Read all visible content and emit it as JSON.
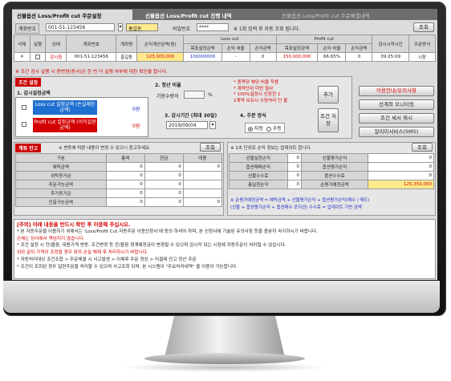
{
  "tabs": [
    "선물옵션 Loss/Profit cut 주문설정",
    "선물옵션 Loss/Profit cut 진행 내역",
    "선물옵션 Loss/Profit cut 주문체결내역"
  ],
  "account": {
    "label": "계좌번호",
    "number": "001-51-123456",
    "name": "홍길동",
    "pw_label": "비밀번호",
    "pw_mask": "****",
    "hint": "※ 1회 입력 후 자동 조회 됩니다.",
    "search": "조회"
  },
  "order_table": {
    "headers": [
      "삭제",
      "실행",
      "상태",
      "계좌번호",
      "계좌명",
      "손익계산금액(원)",
      "목표설정금액",
      "손익 비율",
      "손익금액",
      "목표설정금액",
      "손익 비율",
      "손익금액",
      "감시시작시간",
      "주문방식"
    ],
    "group_loss": "Loss cut",
    "group_profit": "Profit cut",
    "row": {
      "delete": "✕",
      "status": "감시중",
      "account": "001-51-123456",
      "name": "홍길동",
      "base": "123,000,000",
      "loss_target": "100000000",
      "loss_ratio": "-",
      "loss_amount": "0",
      "profit_target": "150,000,000",
      "profit_ratio": "66.65%",
      "profit_amount": "0",
      "time": "09:25:09",
      "method": "시장"
    }
  },
  "warning": "※ 조건 검시 실행 시 증번원(증서)은 한 번 더 실행 여부에 대한 확인을 합니다.",
  "condition": {
    "section": "조건 설정",
    "step1": "1. 감시설정금액",
    "loss_btn": "Loss cut 설정금액 (손실제한금액)",
    "loss_val": "0원",
    "profit_btn": "Profit cut 설정금액 (이익실현금액)",
    "profit_val": "0원",
    "step2": "2. 청산 비율",
    "ratio_label": "가용수량의",
    "ratio_unit": "%",
    "ratio_notes": [
      "* 종목당 해당 비율 작용",
      "* 계약단위 미만 절사",
      "* 100%설정시 신장한 1",
      "  1계약 보유시 수량처리 단 불"
    ],
    "step3": "3. 감시기간 (최대 30일)",
    "date": "2019/09/04",
    "step4": "4. 주문 방식",
    "method_auto": "자동",
    "method_manual": "수동",
    "add": "추가",
    "confirm": "조건 저장"
  },
  "side_buttons": [
    "이용안내/유의사항",
    "선계좌 모니터링",
    "조건 세서 해시",
    "알리미서비스(SMS)"
  ],
  "balance": {
    "title": "계좌 잔고",
    "note": "※ 변동에 따른 내용이 변경 수 있으니 참고하세요.",
    "search": "조회",
    "headers": [
      "구분",
      "총액",
      "현금",
      "대용"
    ],
    "rows": [
      [
        "예탁금액",
        "0",
        "0",
        "0"
      ],
      [
        "위탁증거금",
        "0",
        "0",
        ""
      ],
      [
        "주문가능금액",
        "0",
        "0",
        ""
      ],
      [
        "추가증거금",
        "0",
        "0",
        ""
      ],
      [
        "인출가능금액",
        "0",
        "0",
        "0"
      ]
    ]
  },
  "pnl": {
    "note": "※ 1초 단위로 손익 정보는 업데이트 합니다.",
    "search": "조회",
    "rows": [
      [
        "선물실현손익",
        "0",
        "선물평가손익",
        "0"
      ],
      [
        "옵션매매손익",
        "0",
        "옵션평가손익",
        "0"
      ],
      [
        "선물수수료",
        "0",
        "옵션수수료",
        "0"
      ],
      [
        "총실현손익",
        "0",
        "순평가예정금액",
        "125,350,000"
      ]
    ],
    "formula1": "※ 순평가예정금액 = 예탁금액 + 선물평가손익 + 옵션평가손익(매수 / 매도)",
    "formula2": "  (선물 + 옵션평가손익 + 옵션매수 포지션) 수수료 = 업데이트 기반 금액"
  },
  "notice": {
    "title": "[주의] 아래 내용을 반드시 확인 후 이용해 주십시오.",
    "lines": [
      "* 본 자동주문을 이용하기 위해서는 'Loss/Profit Cut 자동주문 이용신청서'에 동의 하셔야 하며, 본 신청서에 기술된 유의사항 등을 충분히 숙지하시기 바랍니다.",
      "  손해는 당사에서 책임지지 않습니다.",
      "* 조건 설정 시 잔/물음, 대용가격 변동, 조건변경 등 잔/물음 경계예정금이 변경될 수 있으며 감시작 되는 시점에 자동주문이 처리될 수 있습니다.",
      "  위와 같이 가격이 조정될 경우 위의 손실 해제 후 처리하시기 바랍니다.",
      "* 자동처리대상 조건조합 > 주문체결 시 사고발생 > 이체후 주문 정상 > 미결제 잔고 정산 주문",
      "* 조건이 조회된 경우 일련주문을 처리할 수 있으며 사고조회 되며, 본 시스템이 \"주요처리내역\" 을 이용이 가능합니다."
    ]
  }
}
